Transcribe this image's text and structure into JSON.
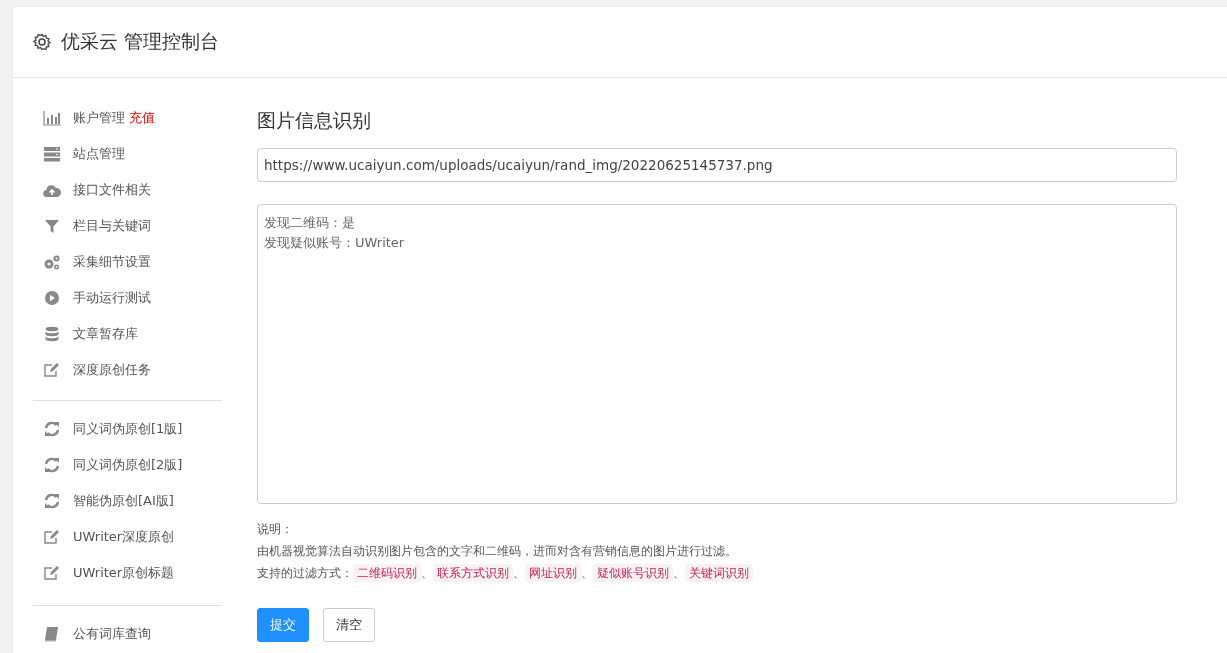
{
  "header": {
    "title": "优采云 管理控制台"
  },
  "sidebar": {
    "groups": [
      {
        "items": [
          {
            "label": "账户管理",
            "badge": "充值"
          },
          {
            "label": "站点管理"
          },
          {
            "label": "接口文件相关"
          },
          {
            "label": "栏目与关键词"
          },
          {
            "label": "采集细节设置"
          },
          {
            "label": "手动运行测试"
          },
          {
            "label": "文章暂存库"
          },
          {
            "label": "深度原创任务"
          }
        ]
      },
      {
        "items": [
          {
            "label": "同义词伪原创[1版]"
          },
          {
            "label": "同义词伪原创[2版]"
          },
          {
            "label": "智能伪原创[AI版]"
          },
          {
            "label": "UWriter深度原创"
          },
          {
            "label": "UWriter原创标题"
          }
        ]
      },
      {
        "items": [
          {
            "label": "公有词库查询"
          }
        ]
      }
    ]
  },
  "main": {
    "title": "图片信息识别",
    "url_field": {
      "value": "https://www.ucaiyun.com/uploads/ucaiyun/rand_img/20220625145737.png"
    },
    "result_box": {
      "lines": [
        "发现二维码：是",
        "发现疑似账号：UWriter"
      ]
    },
    "notes": {
      "heading": "说明：",
      "text": "由机器视觉算法自动识别图片包含的文字和二维码，进而对含有营销信息的图片进行过滤。",
      "filters_label": "支持的过滤方式：",
      "separator": "、",
      "filters": [
        "二维码识别",
        "联系方式识别",
        "网址识别",
        "疑似账号识别",
        "关键词识别"
      ]
    },
    "buttons": [
      {
        "label": "提交",
        "kind": "primary"
      },
      {
        "label": "清空",
        "kind": "default"
      }
    ]
  }
}
